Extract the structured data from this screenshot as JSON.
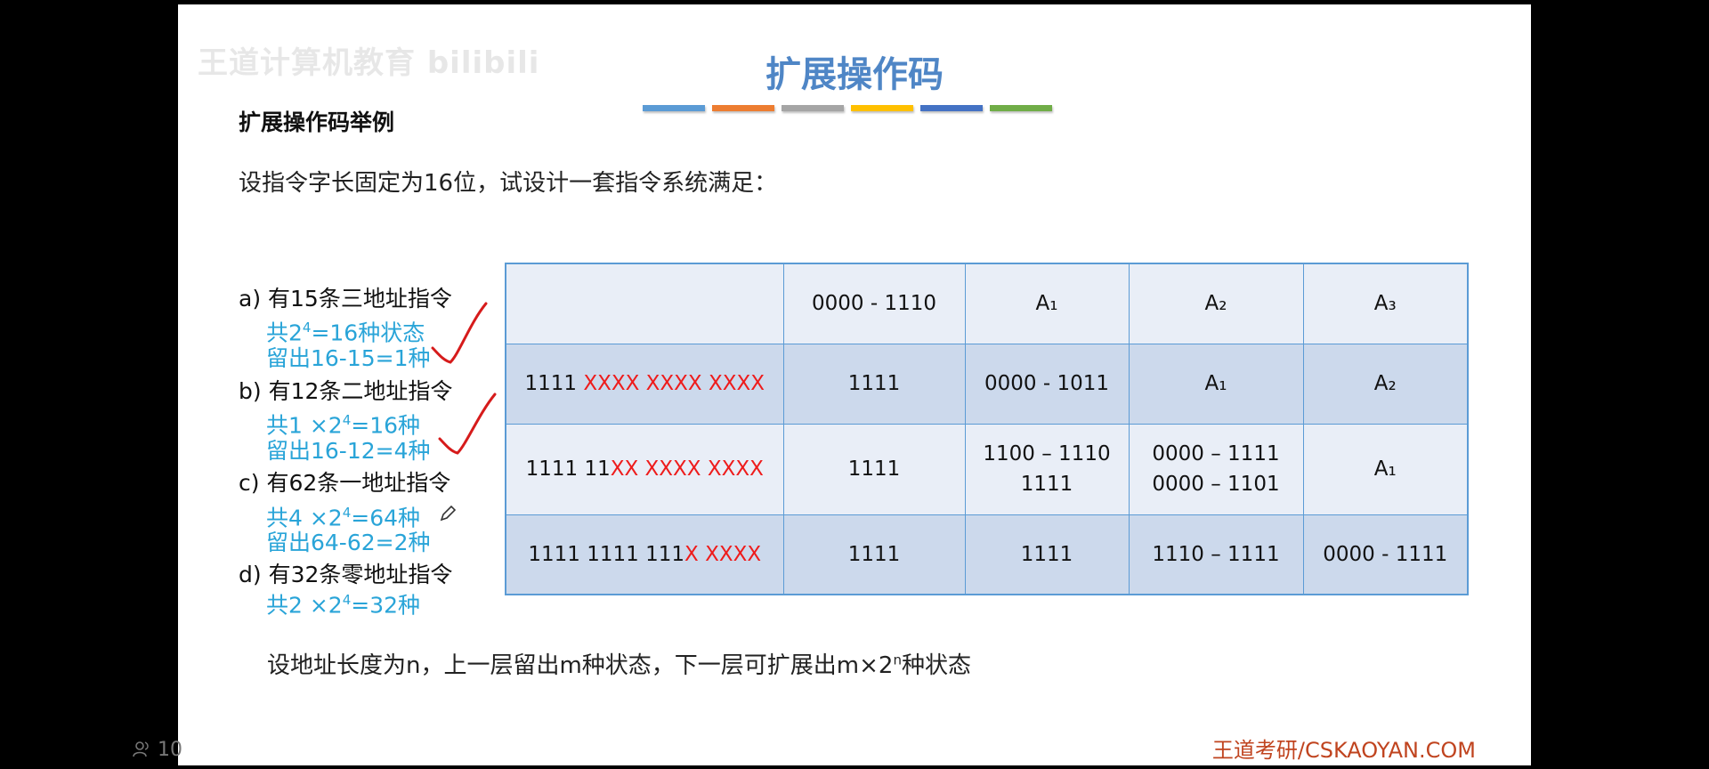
{
  "slide": {
    "title": "扩展操作码",
    "watermark": "王道计算机教育 bilibili",
    "subtitle": "扩展操作码举例",
    "intro": "设指令字长固定为16位，试设计一套指令系统满足：",
    "bar_colors": [
      "#5b9bd5",
      "#ed7d31",
      "#a5a5a5",
      "#ffc000",
      "#4472c4",
      "#70ad47"
    ]
  },
  "requirements": [
    {
      "text": "a) 有15条三地址指令",
      "notes": [
        {
          "pre": "共2",
          "sup": "4",
          "post": "=16种状态"
        },
        {
          "pre": "留出16-15=1种",
          "sup": "",
          "post": ""
        }
      ]
    },
    {
      "text": "b) 有12条二地址指令",
      "notes": [
        {
          "pre": "共1 ×2",
          "sup": "4",
          "post": "=16种"
        },
        {
          "pre": "留出16-12=4种",
          "sup": "",
          "post": ""
        }
      ]
    },
    {
      "text": "c) 有62条一地址指令",
      "notes": [
        {
          "pre": "共4 ×2",
          "sup": "4",
          "post": "=64种"
        },
        {
          "pre": "留出64-62=2种",
          "sup": "",
          "post": ""
        }
      ]
    },
    {
      "text": "d) 有32条零地址指令",
      "notes": [
        {
          "pre": "共2 ×2",
          "sup": "4",
          "post": "=32种"
        }
      ]
    }
  ],
  "table": {
    "rows": [
      {
        "pattern_black": "",
        "pattern_red": "",
        "cells": [
          [
            "0000 - 1110"
          ],
          [
            "A₁"
          ],
          [
            "A₂"
          ],
          [
            "A₃"
          ]
        ]
      },
      {
        "pattern_black": "1111 ",
        "pattern_red": "XXXX XXXX XXXX",
        "cells": [
          [
            "1111"
          ],
          [
            "0000 - 1011"
          ],
          [
            "A₁"
          ],
          [
            "A₂"
          ]
        ]
      },
      {
        "pattern_black": "1111 11",
        "pattern_red": "XX XXXX XXXX",
        "cells": [
          [
            "1111"
          ],
          [
            "1100 – 1110",
            "1111"
          ],
          [
            "0000 – 1111",
            "0000 – 1101"
          ],
          [
            "A₁"
          ]
        ]
      },
      {
        "pattern_black": "1111 1111 111",
        "pattern_red": "X XXXX",
        "cells": [
          [
            "1111"
          ],
          [
            "1111"
          ],
          [
            "1110 – 1111"
          ],
          [
            "0000 - 1111"
          ]
        ]
      }
    ]
  },
  "bottom": {
    "pre": "设地址长度为n，上一层留出m种状态，下一层可扩展出m×2",
    "sup": "n",
    "post": "种状态"
  },
  "footer": {
    "brand": "王道考研/CSKAOYAN.COM"
  },
  "player": {
    "icon": "viewer-icon",
    "count": "10"
  }
}
